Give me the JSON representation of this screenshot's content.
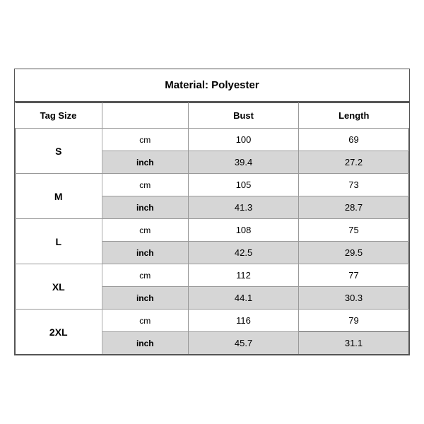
{
  "title": "Material: Polyester",
  "headers": {
    "tag_size": "Tag Size",
    "bust": "Bust",
    "length": "Length"
  },
  "sizes": [
    {
      "tag": "S",
      "cm": {
        "bust": "100",
        "length": "69"
      },
      "inch": {
        "bust": "39.4",
        "length": "27.2"
      }
    },
    {
      "tag": "M",
      "cm": {
        "bust": "105",
        "length": "73"
      },
      "inch": {
        "bust": "41.3",
        "length": "28.7"
      }
    },
    {
      "tag": "L",
      "cm": {
        "bust": "108",
        "length": "75"
      },
      "inch": {
        "bust": "42.5",
        "length": "29.5"
      }
    },
    {
      "tag": "XL",
      "cm": {
        "bust": "112",
        "length": "77"
      },
      "inch": {
        "bust": "44.1",
        "length": "30.3"
      }
    },
    {
      "tag": "2XL",
      "cm": {
        "bust": "116",
        "length": "79"
      },
      "inch": {
        "bust": "45.7",
        "length": "31.1"
      }
    }
  ]
}
